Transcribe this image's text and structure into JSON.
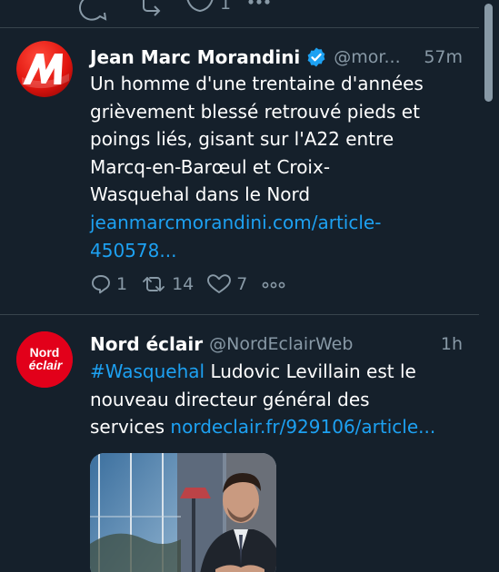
{
  "timeline": {
    "tweets": [
      {
        "author_name": "Jean Marc Morandini",
        "handle": "@mor...",
        "time": "57m",
        "verified": true,
        "text_line1": "Un homme d'une trentaine d'années",
        "text_line2": "grièvement blessé retrouvé pieds et",
        "text_line3": "poings liés, gisant sur l'A22 entre",
        "text_line4": "Marcq-en-Barœul et Croix-",
        "text_line5": "Wasquehal dans le Nord",
        "link_line1": "jeanmarcmorandini.com/article-",
        "link_line2": "450578...",
        "reply_count": "1",
        "retweet_count": "14",
        "like_count": "7",
        "avatar_letter": "M"
      },
      {
        "author_name": "Nord éclair",
        "handle": "@NordEclairWeb",
        "time": "1h",
        "hashtag": "#Wasquehal",
        "text_part1": " Ludovic Levillain est le",
        "text_line2": "nouveau directeur général des",
        "text_line3_prefix": "services ",
        "link": "nordeclair.fr/929106/article...",
        "avatar_line1": "Nord",
        "avatar_line2": "éclair"
      }
    ]
  },
  "colors": {
    "background": "#15202b",
    "divider": "#38444d",
    "secondary_text": "#8899a6",
    "link": "#1da1f2",
    "verified": "#1da1f2",
    "nord_eclair_red": "#e2001a"
  }
}
